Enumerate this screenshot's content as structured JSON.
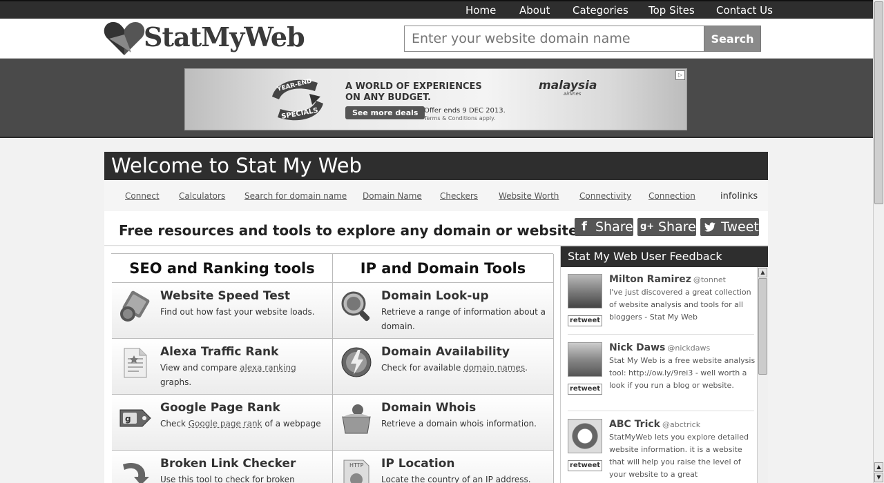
{
  "nav": {
    "items": [
      "Home",
      "About",
      "Categories",
      "Top Sites",
      "Contact Us"
    ]
  },
  "header": {
    "logo_text": "StatMyWeb",
    "search_placeholder": "Enter your website domain name",
    "search_button": "Search"
  },
  "ad": {
    "ribbon_top": "YEAR-END",
    "ribbon_bottom": "SPECIALS",
    "headline_1": "A WORLD OF EXPERIENCES",
    "headline_2": "ON ANY BUDGET.",
    "cta": "See more deals",
    "offer": "Offer ends 9 DEC 2013.",
    "terms": "Terms & Conditions apply.",
    "brand": "malaysia",
    "brand_sub": "airlines"
  },
  "welcome": {
    "title": "Welcome to Stat My Web",
    "links": [
      "Connect",
      "Calculators",
      "Search for domain name",
      "Domain Name",
      "Checkers",
      "Website Worth",
      "Connectivity",
      "Connection"
    ],
    "infolinks": "infolinks"
  },
  "tagline": "Free resources and tools to explore any domain or website",
  "share": {
    "facebook": "Share",
    "google": "Share",
    "twitter": "Tweet"
  },
  "tools": {
    "col1_title": "SEO and Ranking tools",
    "col2_title": "IP and Domain Tools",
    "col1": [
      {
        "title": "Website Speed Test",
        "desc": "Find out how fast your website loads."
      },
      {
        "title": "Alexa Traffic Rank",
        "desc_pre": "View and compare ",
        "link": "alexa ranking",
        "desc_post": " graphs."
      },
      {
        "title": "Google Page Rank",
        "desc_pre": "Check ",
        "link": "Google page rank",
        "desc_post": " of a webpage"
      },
      {
        "title": "Broken Link Checker",
        "desc": "Use this tool to check for broken"
      }
    ],
    "col2": [
      {
        "title": "Domain Look-up",
        "desc": "Retrieve a range of information about a domain."
      },
      {
        "title": "Domain Availability",
        "desc_pre": "Check for available ",
        "link": "domain names",
        "desc_post": "."
      },
      {
        "title": "Domain Whois",
        "desc": "Retrieve a domain whois information."
      },
      {
        "title": "IP Location",
        "desc": "Locate the country of an IP address."
      }
    ]
  },
  "feedback": {
    "title": "Stat My Web User Feedback",
    "retweet": "retweet",
    "items": [
      {
        "name": "Milton Ramirez",
        "handle": "@tonnet",
        "text": "I've just discovered a great collection of website analysis and tools for all bloggers - Stat My Web"
      },
      {
        "name": "Nick Daws",
        "handle": "@nickdaws",
        "text": "Stat My Web is a free website analysis tool: http://ow.ly/9rei3 - well worth a look if you run a blog or website."
      },
      {
        "name": "ABC Trick",
        "handle": "@abctrick",
        "text": "StatMyWeb lets you explore detailed website information. it is a website that will help you raise the level of your website to a great"
      }
    ]
  }
}
